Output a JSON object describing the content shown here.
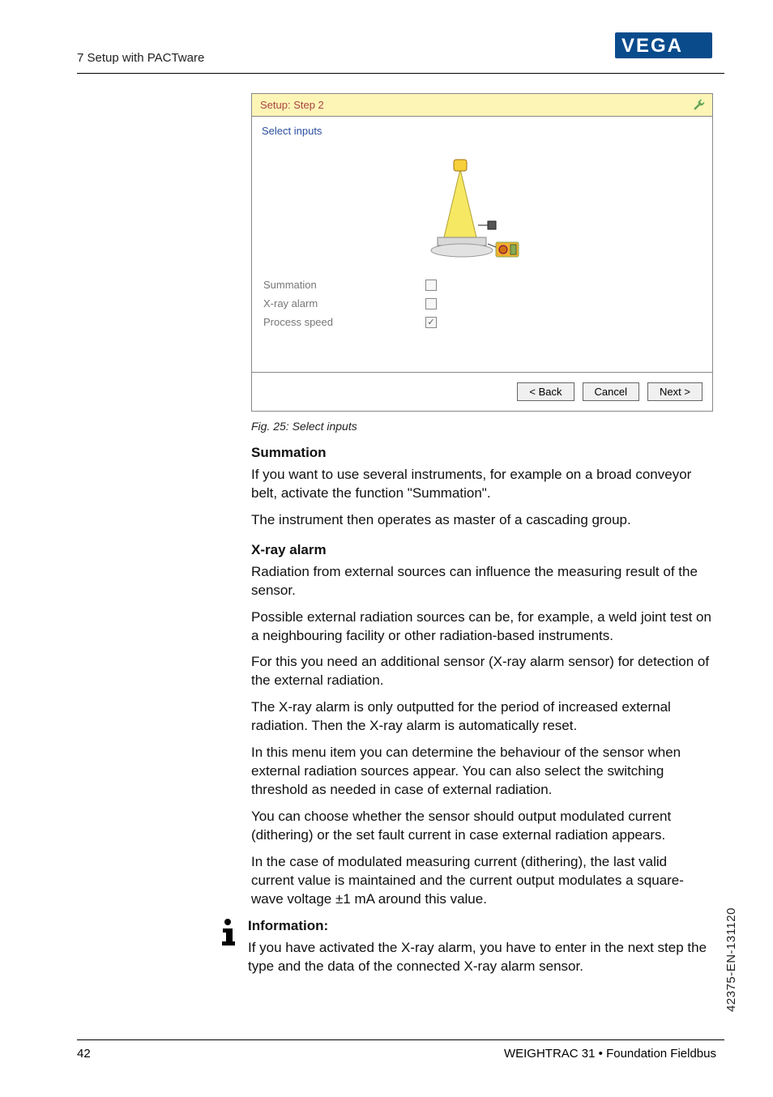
{
  "header": {
    "section": "7 Setup with PACTware"
  },
  "panel": {
    "title": "Setup: Step 2",
    "inputs_label": "Select inputs",
    "rows": {
      "summation": "Summation",
      "xray": "X-ray alarm",
      "speed": "Process speed"
    },
    "buttons": {
      "back": "< Back",
      "cancel": "Cancel",
      "next": "Next >"
    }
  },
  "caption": "Fig. 25: Select inputs",
  "body": {
    "summation_h": "Summation",
    "summation_p1": "If you want to use several instruments, for example on a broad conveyor belt, activate the function \"Summation\".",
    "summation_p2": "The instrument then operates as master of a cascading group.",
    "xray_h": "X-ray alarm",
    "xray_p1": "Radiation from external sources can influence the measuring result of the sensor.",
    "xray_p2": "Possible external radiation sources can be, for example, a weld joint test on a neighbouring facility or other radiation-based instruments.",
    "xray_p3": "For this you need an additional sensor (X-ray alarm sensor) for detection of the external radiation.",
    "xray_p4": "The X-ray alarm is only outputted for the period of increased external radiation. Then the X-ray alarm is automatically reset.",
    "xray_p5": "In this menu item you can determine the behaviour of the sensor when external radiation sources appear. You can also select the switching threshold as needed in case of external radiation.",
    "xray_p6": "You can choose whether the sensor should output modulated current (dithering) or the set fault current in case external radiation appears.",
    "xray_p7": "In the case of modulated measuring current (dithering), the last valid current value is maintained and the current output modulates a square-wave voltage ±1 mA around this value.",
    "info_h": "Information:",
    "info_p": "If you have activated the X-ray alarm, you have to enter in the next step the type and the data of the connected X-ray alarm sensor."
  },
  "footer": {
    "page": "42",
    "title": "WEIGHTRAC 31 • Foundation Fieldbus",
    "side_code": "42375-EN-131120"
  }
}
